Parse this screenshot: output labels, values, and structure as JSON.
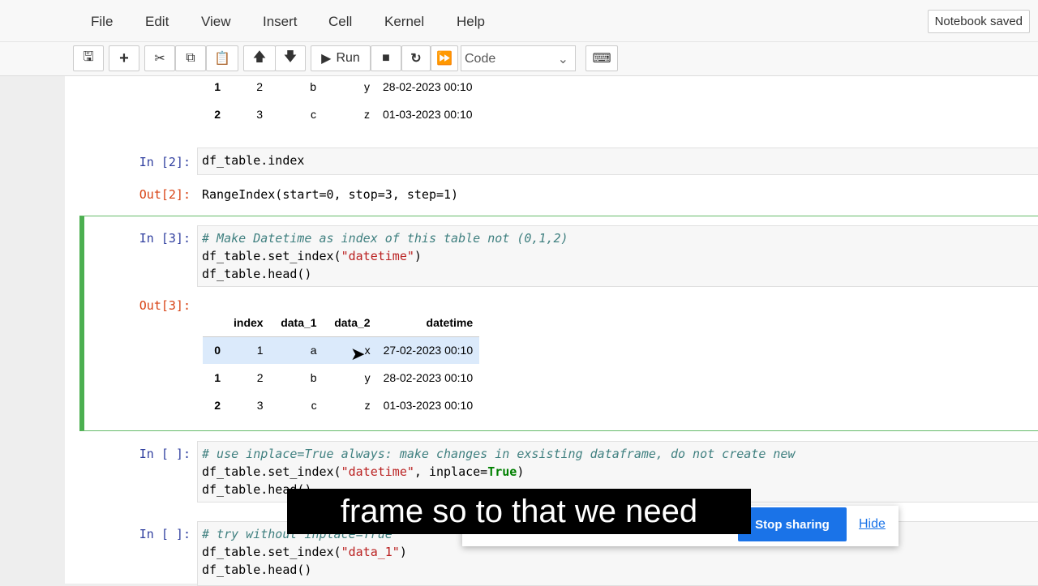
{
  "menu": [
    "File",
    "Edit",
    "View",
    "Insert",
    "Cell",
    "Kernel",
    "Help"
  ],
  "status": "Notebook saved",
  "toolbar": {
    "run": "Run",
    "cell_type": "Code"
  },
  "prev_rows": [
    [
      "1",
      "2",
      "b",
      "y",
      "28-02-2023 00:10"
    ],
    [
      "2",
      "3",
      "c",
      "z",
      "01-03-2023 00:10"
    ]
  ],
  "cell2": {
    "prompt": "In [2]:",
    "code": "df_table.index",
    "out_prompt": "Out[2]:",
    "output": "RangeIndex(start=0, stop=3, step=1)"
  },
  "cell3": {
    "prompt": "In [3]:",
    "comment": "# Make Datetime as index of this table not (0,1,2)",
    "l2a": "df_table.set_index(",
    "l2s": "\"datetime\"",
    "l2b": ")",
    "l3": "df_table.head()",
    "out_prompt": "Out[3]:",
    "headers": [
      "",
      "index",
      "data_1",
      "data_2",
      "datetime"
    ],
    "rows": [
      [
        "0",
        "1",
        "a",
        "x",
        "27-02-2023 00:10"
      ],
      [
        "1",
        "2",
        "b",
        "y",
        "28-02-2023 00:10"
      ],
      [
        "2",
        "3",
        "c",
        "z",
        "01-03-2023 00:10"
      ]
    ]
  },
  "cell4": {
    "prompt": "In [ ]:",
    "comment": "# use inplace=True always: make changes in exsisting dataframe, do not create new",
    "l2a": "df_table.set_index(",
    "l2s": "\"datetime\"",
    "l2b": ", inplace=",
    "l2k": "True",
    "l2c": ")",
    "l3": "df_table.head()"
  },
  "cell5": {
    "prompt": "In [ ]:",
    "comment": "# try without inplace=True",
    "l2a": "df_table.set_index(",
    "l2s": "\"data_1\"",
    "l2b": ")",
    "l3": "df_table.head()"
  },
  "caption": "frame so to that we need",
  "sharing": {
    "stop": "Stop sharing",
    "hide": "Hide"
  }
}
